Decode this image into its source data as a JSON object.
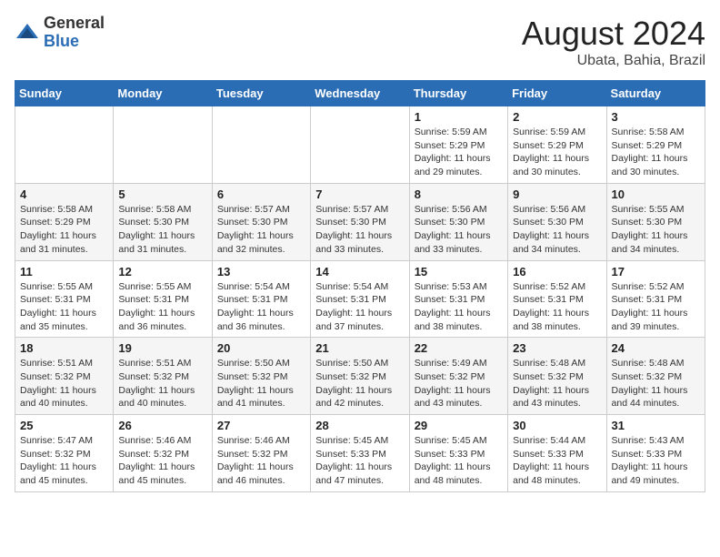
{
  "header": {
    "logo_general": "General",
    "logo_blue": "Blue",
    "month_year": "August 2024",
    "location": "Ubata, Bahia, Brazil"
  },
  "weekdays": [
    "Sunday",
    "Monday",
    "Tuesday",
    "Wednesday",
    "Thursday",
    "Friday",
    "Saturday"
  ],
  "weeks": [
    [
      {
        "day": "",
        "info": ""
      },
      {
        "day": "",
        "info": ""
      },
      {
        "day": "",
        "info": ""
      },
      {
        "day": "",
        "info": ""
      },
      {
        "day": "1",
        "info": "Sunrise: 5:59 AM\nSunset: 5:29 PM\nDaylight: 11 hours\nand 29 minutes."
      },
      {
        "day": "2",
        "info": "Sunrise: 5:59 AM\nSunset: 5:29 PM\nDaylight: 11 hours\nand 30 minutes."
      },
      {
        "day": "3",
        "info": "Sunrise: 5:58 AM\nSunset: 5:29 PM\nDaylight: 11 hours\nand 30 minutes."
      }
    ],
    [
      {
        "day": "4",
        "info": "Sunrise: 5:58 AM\nSunset: 5:29 PM\nDaylight: 11 hours\nand 31 minutes."
      },
      {
        "day": "5",
        "info": "Sunrise: 5:58 AM\nSunset: 5:30 PM\nDaylight: 11 hours\nand 31 minutes."
      },
      {
        "day": "6",
        "info": "Sunrise: 5:57 AM\nSunset: 5:30 PM\nDaylight: 11 hours\nand 32 minutes."
      },
      {
        "day": "7",
        "info": "Sunrise: 5:57 AM\nSunset: 5:30 PM\nDaylight: 11 hours\nand 33 minutes."
      },
      {
        "day": "8",
        "info": "Sunrise: 5:56 AM\nSunset: 5:30 PM\nDaylight: 11 hours\nand 33 minutes."
      },
      {
        "day": "9",
        "info": "Sunrise: 5:56 AM\nSunset: 5:30 PM\nDaylight: 11 hours\nand 34 minutes."
      },
      {
        "day": "10",
        "info": "Sunrise: 5:55 AM\nSunset: 5:30 PM\nDaylight: 11 hours\nand 34 minutes."
      }
    ],
    [
      {
        "day": "11",
        "info": "Sunrise: 5:55 AM\nSunset: 5:31 PM\nDaylight: 11 hours\nand 35 minutes."
      },
      {
        "day": "12",
        "info": "Sunrise: 5:55 AM\nSunset: 5:31 PM\nDaylight: 11 hours\nand 36 minutes."
      },
      {
        "day": "13",
        "info": "Sunrise: 5:54 AM\nSunset: 5:31 PM\nDaylight: 11 hours\nand 36 minutes."
      },
      {
        "day": "14",
        "info": "Sunrise: 5:54 AM\nSunset: 5:31 PM\nDaylight: 11 hours\nand 37 minutes."
      },
      {
        "day": "15",
        "info": "Sunrise: 5:53 AM\nSunset: 5:31 PM\nDaylight: 11 hours\nand 38 minutes."
      },
      {
        "day": "16",
        "info": "Sunrise: 5:52 AM\nSunset: 5:31 PM\nDaylight: 11 hours\nand 38 minutes."
      },
      {
        "day": "17",
        "info": "Sunrise: 5:52 AM\nSunset: 5:31 PM\nDaylight: 11 hours\nand 39 minutes."
      }
    ],
    [
      {
        "day": "18",
        "info": "Sunrise: 5:51 AM\nSunset: 5:32 PM\nDaylight: 11 hours\nand 40 minutes."
      },
      {
        "day": "19",
        "info": "Sunrise: 5:51 AM\nSunset: 5:32 PM\nDaylight: 11 hours\nand 40 minutes."
      },
      {
        "day": "20",
        "info": "Sunrise: 5:50 AM\nSunset: 5:32 PM\nDaylight: 11 hours\nand 41 minutes."
      },
      {
        "day": "21",
        "info": "Sunrise: 5:50 AM\nSunset: 5:32 PM\nDaylight: 11 hours\nand 42 minutes."
      },
      {
        "day": "22",
        "info": "Sunrise: 5:49 AM\nSunset: 5:32 PM\nDaylight: 11 hours\nand 43 minutes."
      },
      {
        "day": "23",
        "info": "Sunrise: 5:48 AM\nSunset: 5:32 PM\nDaylight: 11 hours\nand 43 minutes."
      },
      {
        "day": "24",
        "info": "Sunrise: 5:48 AM\nSunset: 5:32 PM\nDaylight: 11 hours\nand 44 minutes."
      }
    ],
    [
      {
        "day": "25",
        "info": "Sunrise: 5:47 AM\nSunset: 5:32 PM\nDaylight: 11 hours\nand 45 minutes."
      },
      {
        "day": "26",
        "info": "Sunrise: 5:46 AM\nSunset: 5:32 PM\nDaylight: 11 hours\nand 45 minutes."
      },
      {
        "day": "27",
        "info": "Sunrise: 5:46 AM\nSunset: 5:32 PM\nDaylight: 11 hours\nand 46 minutes."
      },
      {
        "day": "28",
        "info": "Sunrise: 5:45 AM\nSunset: 5:33 PM\nDaylight: 11 hours\nand 47 minutes."
      },
      {
        "day": "29",
        "info": "Sunrise: 5:45 AM\nSunset: 5:33 PM\nDaylight: 11 hours\nand 48 minutes."
      },
      {
        "day": "30",
        "info": "Sunrise: 5:44 AM\nSunset: 5:33 PM\nDaylight: 11 hours\nand 48 minutes."
      },
      {
        "day": "31",
        "info": "Sunrise: 5:43 AM\nSunset: 5:33 PM\nDaylight: 11 hours\nand 49 minutes."
      }
    ]
  ]
}
